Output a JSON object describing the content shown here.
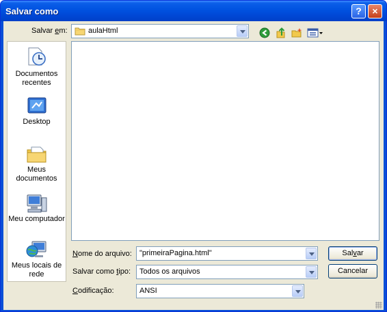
{
  "window": {
    "title": "Salvar como",
    "help_glyph": "?",
    "close_glyph": "×"
  },
  "save_in": {
    "label_prefix": "Salvar ",
    "label_accel": "e",
    "label_suffix": "m:",
    "value": "aulaHtml"
  },
  "toolbar": {
    "icons": [
      "back-icon",
      "up-folder-icon",
      "new-folder-icon",
      "view-menu-icon"
    ]
  },
  "places": [
    {
      "label": "Documentos recentes",
      "icon": "recent-documents-icon"
    },
    {
      "label": "Desktop",
      "icon": "desktop-icon"
    },
    {
      "label": "Meus documentos",
      "icon": "my-documents-icon"
    },
    {
      "label": "Meu computador",
      "icon": "my-computer-icon"
    },
    {
      "label": "Meus locais de rede",
      "icon": "network-places-icon"
    }
  ],
  "filename": {
    "label_accel": "N",
    "label_rest": "ome do arquivo:",
    "value": "\"primeiraPagina.html\""
  },
  "filetype": {
    "label_prefix": "Salvar como ",
    "label_accel": "t",
    "label_suffix": "ipo:",
    "value": "Todos os arquivos"
  },
  "encoding": {
    "label_accel": "C",
    "label_rest": "odificação:",
    "value": "ANSI"
  },
  "buttons": {
    "save_prefix": "Sal",
    "save_accel": "v",
    "save_suffix": "ar",
    "cancel": "Cancelar"
  },
  "colors": {
    "title_bar": "#0054e3",
    "dialog_bg": "#ece9d8",
    "field_border": "#7f9db9",
    "button_border": "#003c74"
  }
}
